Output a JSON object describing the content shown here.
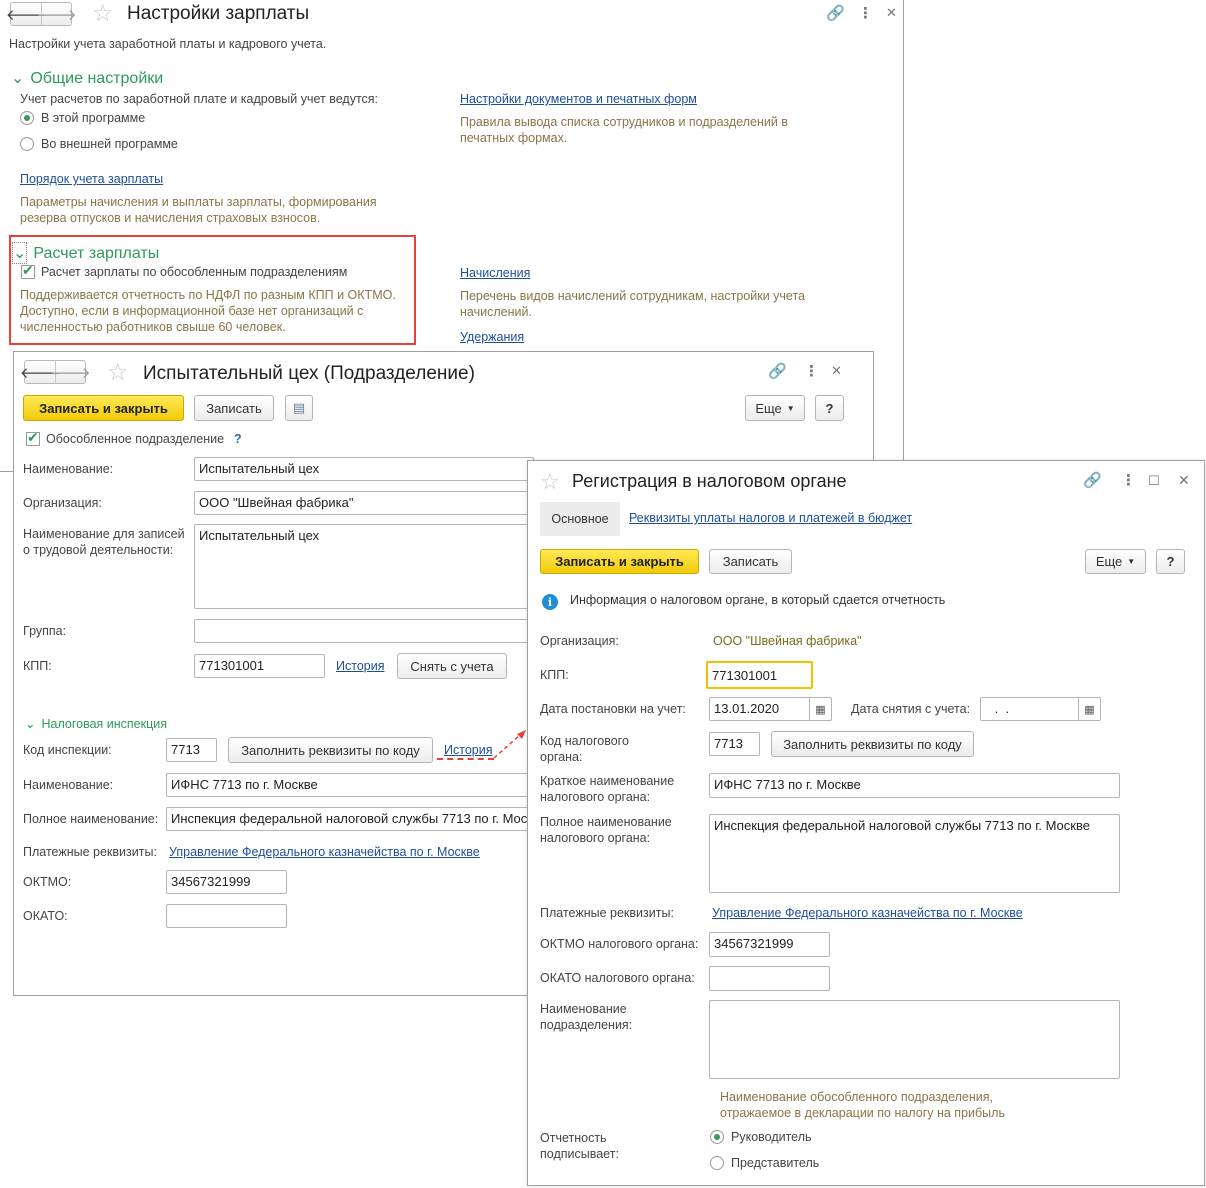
{
  "settings": {
    "title": "Настройки зарплаты",
    "subtitle": "Настройки учета заработной платы и кадрового учета.",
    "general": {
      "header": "Общие настройки",
      "accounting_question": "Учет расчетов по заработной плате и кадровый учет ведутся:",
      "radio_this": "В этой программе",
      "radio_external": "Во внешней программе",
      "salary_order_link": "Порядок учета зарплаты",
      "salary_order_hint": "Параметры начисления и выплаты зарплаты, формирования резерва отпусков и начисления страховых взносов.",
      "docs_link": "Настройки документов и печатных форм",
      "docs_hint": "Правила вывода списка сотрудников и подразделений в печатных формах."
    },
    "payroll": {
      "header": "Расчет зарплаты",
      "checkbox_label": "Расчет зарплаты по обособленным подразделениям",
      "hint": "Поддерживается отчетность по НДФЛ по разным КПП и ОКТМО. Доступно, если в информационной базе нет организаций с численностью работников свыше 60 человек.",
      "accruals_link": "Начисления",
      "accruals_hint": "Перечень видов начислений сотрудникам, настройки учета начислений.",
      "deductions_link": "Удержания"
    }
  },
  "division": {
    "title": "Испытательный цех (Подразделение)",
    "save_close": "Записать и закрыть",
    "save": "Записать",
    "more": "Еще",
    "help": "?",
    "separate_label": "Обособленное подразделение",
    "separate_help": "?",
    "name_label": "Наименование:",
    "name_value": "Испытательный цех",
    "org_label": "Организация:",
    "org_value": "ООО \"Швейная фабрика\"",
    "labor_name_label": "Наименование для записей о трудовой деятельности:",
    "labor_name_value": "Испытательный цех",
    "group_label": "Группа:",
    "kpp_label": "КПП:",
    "kpp_value": "771301001",
    "history_link": "История",
    "deregister_btn": "Снять с учета",
    "tax_section": "Налоговая инспекция",
    "inspection_code_label": "Код инспекции:",
    "inspection_code_value": "7713",
    "fill_btn": "Заполнить реквизиты по коду",
    "history_link2": "История",
    "ins_name_label": "Наименование:",
    "ins_name_value": "ИФНС 7713 по г. Москве",
    "full_name_label": "Полное наименование:",
    "full_name_value": "Инспекция федеральной налоговой службы 7713 по г. Москве",
    "payment_label": "Платежные реквизиты:",
    "payment_link": "Управление Федерального казначейства по г. Москве",
    "oktmo_label": "ОКТМО:",
    "oktmo_value": "34567321999",
    "okato_label": "ОКАТО:",
    "okato_value": ""
  },
  "registration": {
    "title": "Регистрация в налоговом органе",
    "tab_main": "Основное",
    "tab_payments": "Реквизиты уплаты налогов и платежей в бюджет",
    "save_close": "Записать и закрыть",
    "save": "Записать",
    "more": "Еще",
    "help": "?",
    "info": "Информация о налоговом органе, в который сдается отчетность",
    "org_label": "Организация:",
    "org_value": "ООО \"Швейная фабрика\"",
    "kpp_label": "КПП:",
    "kpp_value": "771301001",
    "reg_date_label": "Дата постановки на учет:",
    "reg_date_value": "13.01.2020",
    "dereg_date_label": "Дата снятия с учета:",
    "dereg_date_value": " .  .",
    "code_label": "Код налогового органа:",
    "code_value": "7713",
    "fill_btn": "Заполнить реквизиты по коду",
    "short_name_label": "Краткое наименование налогового органа:",
    "short_name_value": "ИФНС 7713 по г. Москве",
    "full_name_label": "Полное наименование налогового органа:",
    "full_name_value": "Инспекция федеральной налоговой службы 7713 по г. Москве",
    "payment_label": "Платежные реквизиты:",
    "payment_link": "Управление Федерального казначейства по г. Москве",
    "oktmo_label": "ОКТМО налогового органа:",
    "oktmo_value": "34567321999",
    "okato_label": "ОКАТО налогового органа:",
    "okato_value": "",
    "division_name_label": "Наименование подразделения:",
    "division_name_value": "",
    "division_hint": "Наименование обособленного подразделения, отражаемое в декларации по налогу на прибыль",
    "signer_label": "Отчетность подписывает:",
    "signer_head": "Руководитель",
    "signer_rep": "Представитель"
  },
  "colors": {
    "accent_green": "#2e9a5a",
    "link_blue": "#1d4e9c",
    "hint_brown": "#8a7548",
    "highlight_red": "#e8403a",
    "button_yellow": "#f2cb08",
    "focus_orange": "#f0c000"
  }
}
